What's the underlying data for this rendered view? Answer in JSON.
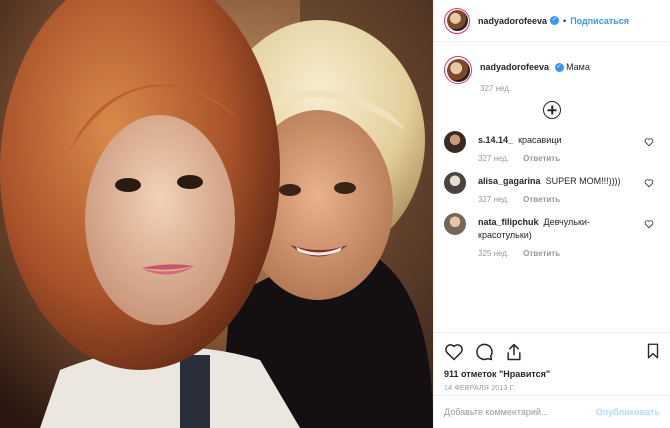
{
  "header": {
    "username": "nadyadorofeeva",
    "follow_label": "Подписаться",
    "separator": "•"
  },
  "caption": {
    "username": "nadyadorofeeva",
    "text": "Мама",
    "age": "327 нед."
  },
  "comments": [
    {
      "username": "s.14.14_",
      "text": "красавици",
      "age": "327 нед.",
      "reply": "Ответить"
    },
    {
      "username": "alisa_gagarina",
      "text": "SUPER MOM!!!))))",
      "age": "327 нед.",
      "reply": "Ответить"
    },
    {
      "username": "nata_filipchuk",
      "text": "Девчульки-красотульки)",
      "age": "325 нед.",
      "reply": "Ответить"
    }
  ],
  "actions": {
    "likes": "911 отметок \"Нравится\"",
    "date": "14 ФЕВРАЛЯ 2013 Г."
  },
  "add_comment": {
    "placeholder": "Добавьте комментарий...",
    "publish_label": "Опубликовать"
  },
  "colors": {
    "accent": "#3897f0",
    "publish_disabled": "#b3dbff",
    "muted": "#999999"
  }
}
